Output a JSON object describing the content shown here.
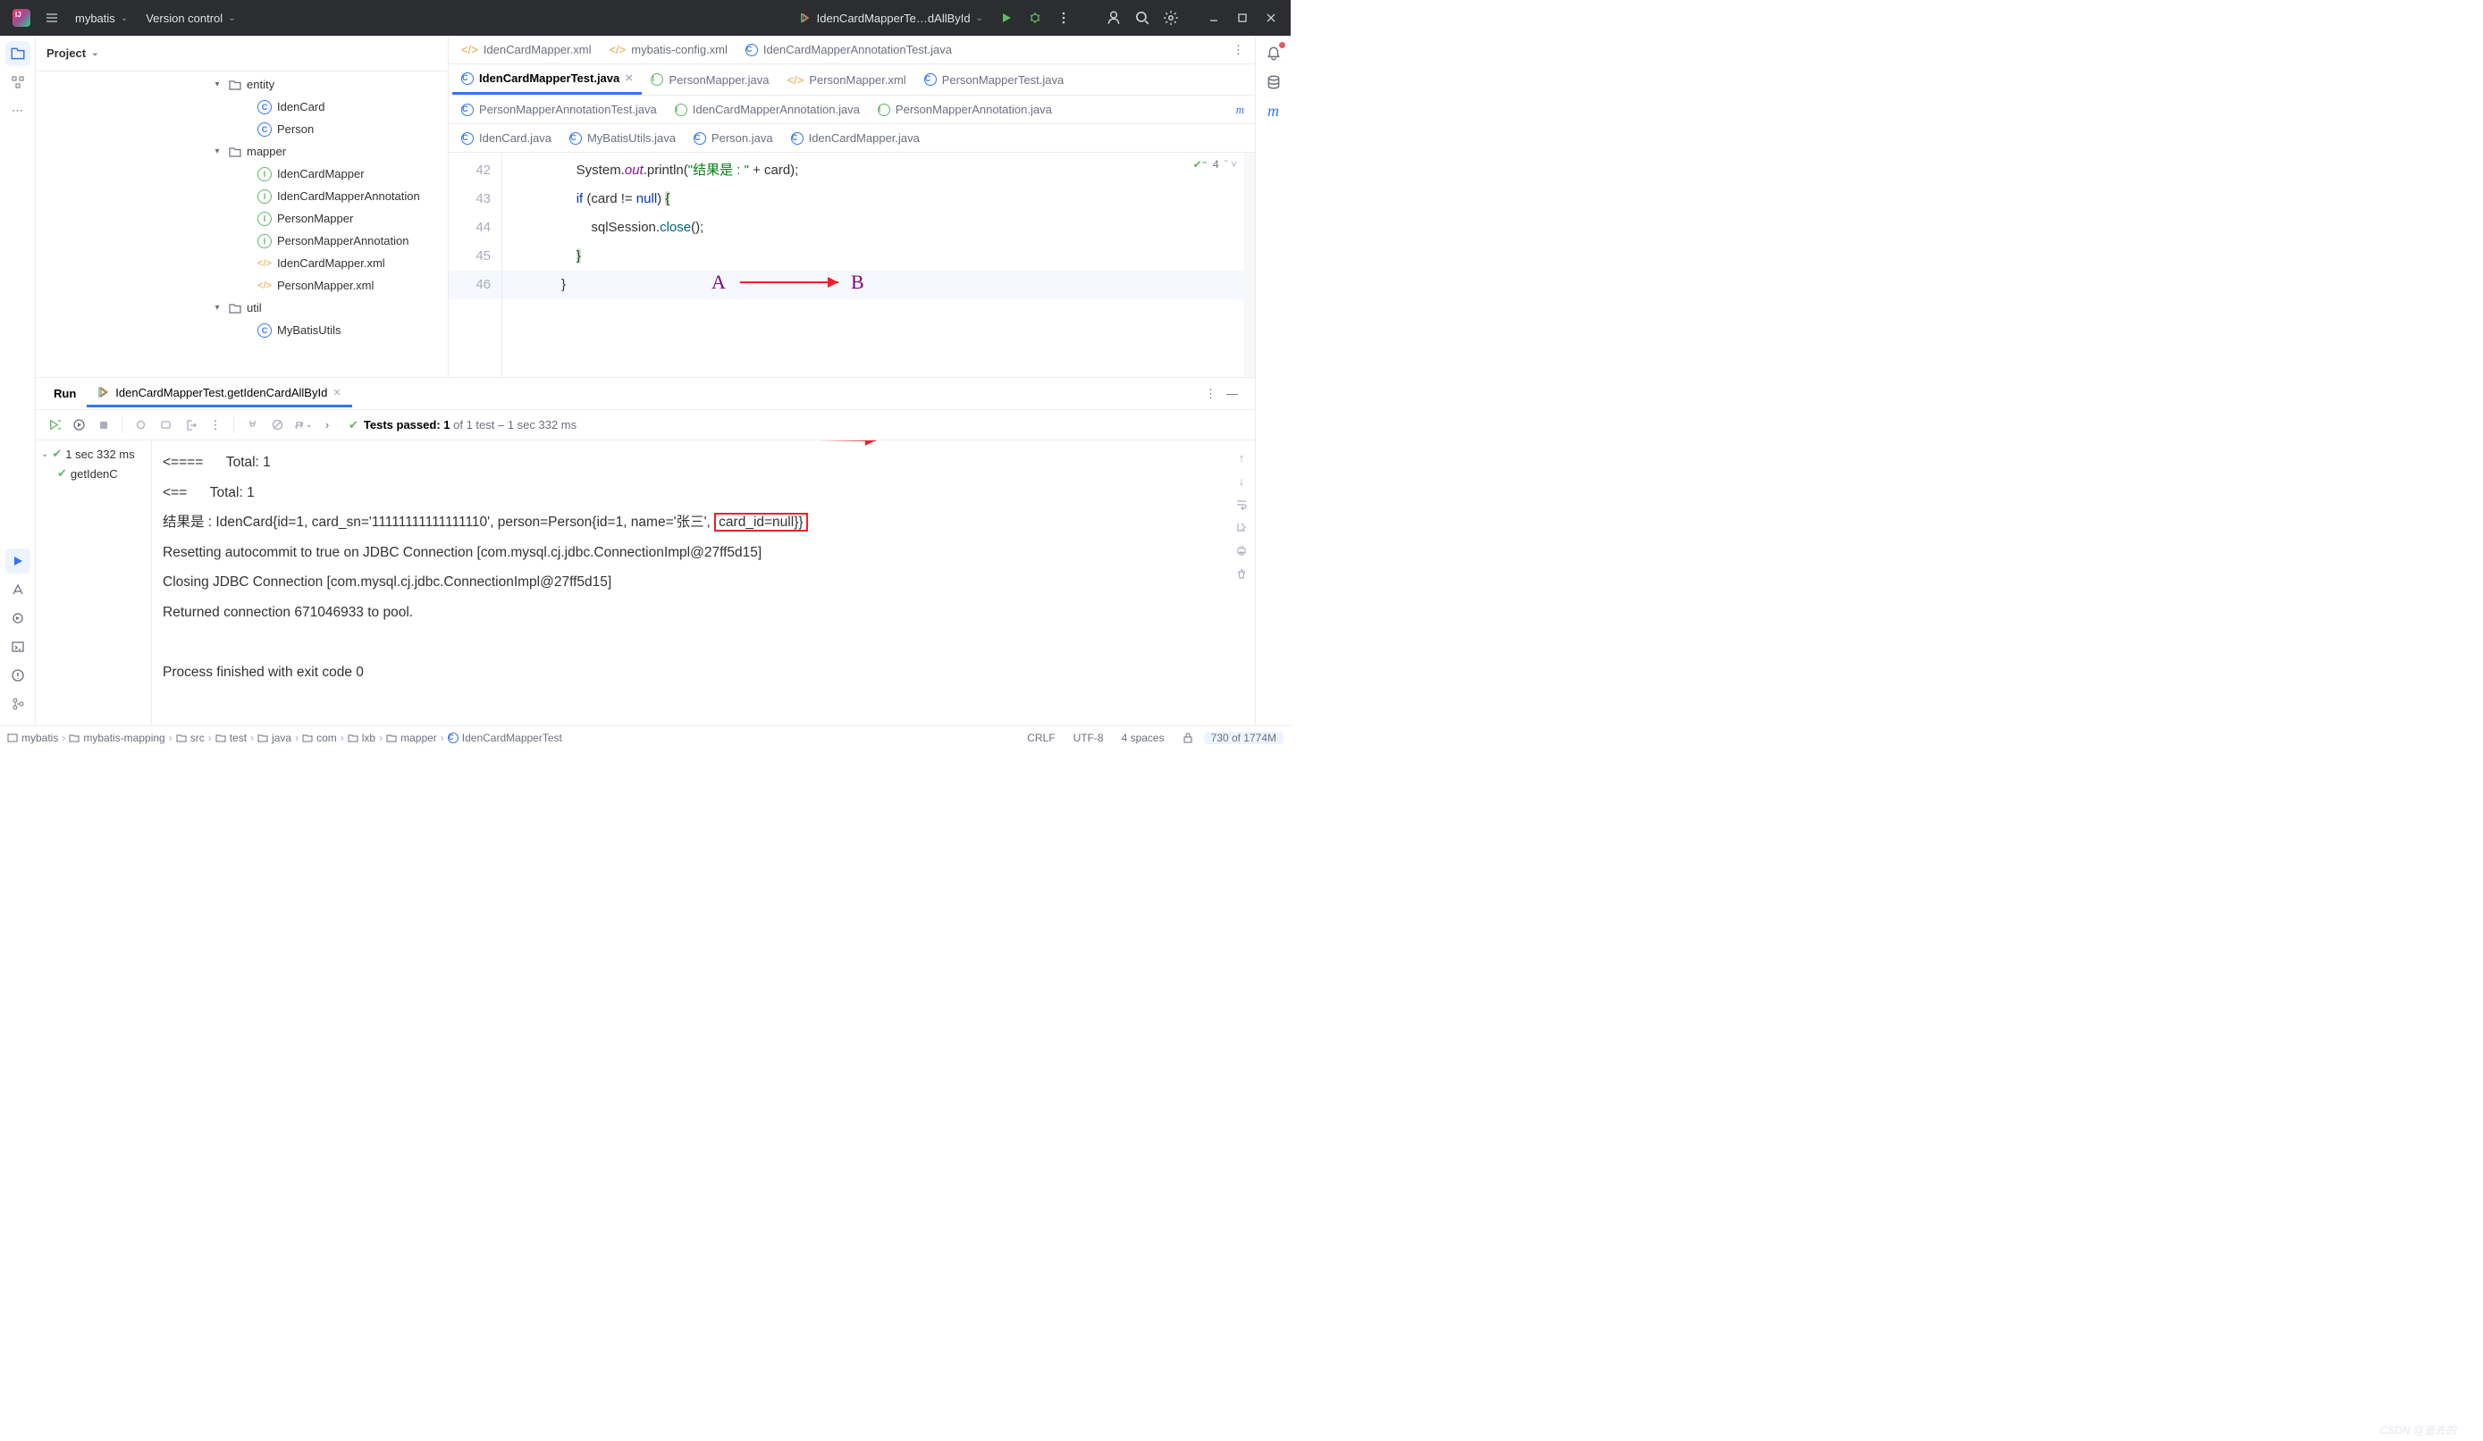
{
  "titlebar": {
    "project": "mybatis",
    "vcs": "Version control",
    "runconfig": "IdenCardMapperTe…dAllById"
  },
  "projectPanel": {
    "title": "Project"
  },
  "tree": [
    {
      "indent": 196,
      "arrow": "▾",
      "icon": "folder",
      "label": "entity"
    },
    {
      "indent": 228,
      "arrow": "",
      "icon": "class",
      "label": "IdenCard"
    },
    {
      "indent": 228,
      "arrow": "",
      "icon": "class",
      "label": "Person"
    },
    {
      "indent": 196,
      "arrow": "▾",
      "icon": "folder",
      "label": "mapper"
    },
    {
      "indent": 228,
      "arrow": "",
      "icon": "iface",
      "label": "IdenCardMapper"
    },
    {
      "indent": 228,
      "arrow": "",
      "icon": "iface",
      "label": "IdenCardMapperAnnotation"
    },
    {
      "indent": 228,
      "arrow": "",
      "icon": "iface",
      "label": "PersonMapper"
    },
    {
      "indent": 228,
      "arrow": "",
      "icon": "iface",
      "label": "PersonMapperAnnotation"
    },
    {
      "indent": 228,
      "arrow": "",
      "icon": "xml",
      "label": "IdenCardMapper.xml"
    },
    {
      "indent": 228,
      "arrow": "",
      "icon": "xml",
      "label": "PersonMapper.xml"
    },
    {
      "indent": 196,
      "arrow": "▾",
      "icon": "folder",
      "label": "util"
    },
    {
      "indent": 228,
      "arrow": "",
      "icon": "class",
      "label": "MyBatisUtils"
    }
  ],
  "tabsRow1": [
    {
      "icon": "xml",
      "label": "IdenCardMapper.xml"
    },
    {
      "icon": "xml",
      "label": "mybatis-config.xml"
    },
    {
      "icon": "class",
      "label": "IdenCardMapperAnnotationTest.java"
    }
  ],
  "tabsRow2": [
    {
      "icon": "class",
      "label": "IdenCardMapperTest.java",
      "active": true,
      "close": true
    },
    {
      "icon": "iface",
      "label": "PersonMapper.java"
    },
    {
      "icon": "xml",
      "label": "PersonMapper.xml"
    },
    {
      "icon": "class",
      "label": "PersonMapperTest.java"
    }
  ],
  "tabsRow3": [
    {
      "icon": "class",
      "label": "PersonMapperAnnotationTest.java"
    },
    {
      "icon": "iface",
      "label": "IdenCardMapperAnnotation.java"
    },
    {
      "icon": "iface",
      "label": "PersonMapperAnnotation.java"
    }
  ],
  "tabsRow4": [
    {
      "icon": "class",
      "label": "IdenCard.java"
    },
    {
      "icon": "class",
      "label": "MyBatisUtils.java"
    },
    {
      "icon": "class",
      "label": "Person.java"
    },
    {
      "icon": "class",
      "label": "IdenCardMapper.java"
    }
  ],
  "gutter": [
    "42",
    "43",
    "44",
    "45",
    "46"
  ],
  "code": {
    "l42a": "                System.",
    "l42b": "out",
    "l42c": ".println(",
    "l42d": "\"结果是 : \"",
    "l42e": " + card);",
    "l43a": "                ",
    "l43b": "if",
    "l43c": " (card != ",
    "l43d": "null",
    "l43e": ") ",
    "l43f": "{",
    "l44a": "                    sqlSession.",
    "l44b": "close",
    "l44c": "();",
    "l45a": "                ",
    "l45b": "}",
    "l46": "            }"
  },
  "inspections": {
    "count": "4"
  },
  "anno": {
    "a": "A",
    "b": "B"
  },
  "run": {
    "tab1": "Run",
    "tab2": "IdenCardMapperTest.getIdenCardAllById",
    "status_pre": "Tests passed: 1",
    "status_post": " of 1 test – 1 sec 332 ms",
    "root_time": "1 sec 332 ms",
    "test_name": "getIdenC"
  },
  "console": {
    "l1": "<====      Total: 1",
    "l2": "<==      Total: 1",
    "l3a": "结果是 : IdenCard{id=1, card_sn='11111111111111110', person=Person{id=1, name='张三', ",
    "l3b": "card_id=null}}",
    "l4": "Resetting autocommit to true on JDBC Connection [com.mysql.cj.jdbc.ConnectionImpl@27ff5d15]",
    "l5": "Closing JDBC Connection [com.mysql.cj.jdbc.ConnectionImpl@27ff5d15]",
    "l6": "Returned connection 671046933 to pool.",
    "l7": "",
    "l8": "Process finished with exit code 0"
  },
  "breadcrumbs": [
    "mybatis",
    "mybatis-mapping",
    "src",
    "test",
    "java",
    "com",
    "lxb",
    "mapper",
    "IdenCardMapperTest"
  ],
  "status": {
    "lf": "CRLF",
    "enc": "UTF-8",
    "indent": "4 spaces",
    "mem": "730 of 1774M"
  },
  "watermark": "CSDN @逝去的"
}
